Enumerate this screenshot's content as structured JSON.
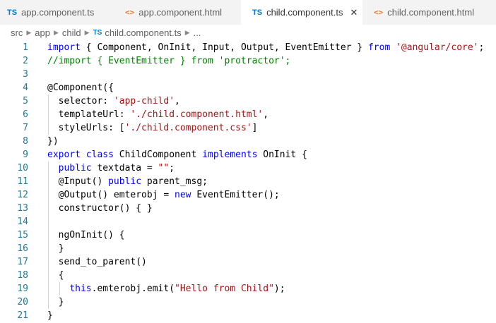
{
  "tabs": [
    {
      "icon": "TS",
      "label": "app.component.ts",
      "type": "ts",
      "active": false
    },
    {
      "icon": "<>",
      "label": "app.component.html",
      "type": "html",
      "active": false
    },
    {
      "icon": "TS",
      "label": "child.component.ts",
      "type": "ts",
      "active": true
    },
    {
      "icon": "<>",
      "label": "child.component.html",
      "type": "html",
      "active": false
    }
  ],
  "close_glyph": "✕",
  "breadcrumb": {
    "items": [
      "src",
      "app",
      "child"
    ],
    "file_icon": "TS",
    "file": "child.component.ts",
    "more": "..."
  },
  "code": {
    "line_numbers": [
      "1",
      "2",
      "3",
      "4",
      "5",
      "6",
      "7",
      "8",
      "9",
      "10",
      "11",
      "12",
      "13",
      "14",
      "15",
      "16",
      "17",
      "18",
      "19",
      "20",
      "21"
    ],
    "lines": [
      "import { Component, OnInit, Input, Output, EventEmitter } from '@angular/core';",
      "//import { EventEmitter } from 'protractor';",
      "",
      "@Component({",
      "  selector: 'app-child',",
      "  templateUrl: './child.component.html',",
      "  styleUrls: ['./child.component.css']",
      "})",
      "export class ChildComponent implements OnInit {",
      "  public textdata = \"\";",
      "  @Input() public parent_msg;",
      "  @Output() emterobj = new EventEmitter();",
      "  constructor() { }",
      "",
      "  ngOnInit() {",
      "  }",
      "  send_to_parent()",
      "  {",
      "    this.emterobj.emit(\"Hello from Child\");",
      "  }",
      "}"
    ]
  },
  "colors": {
    "keyword": "#0000ff",
    "string": "#a31515",
    "comment": "#008000",
    "line_number": "#237893",
    "ts_icon": "#007acc",
    "html_icon": "#e37933"
  }
}
